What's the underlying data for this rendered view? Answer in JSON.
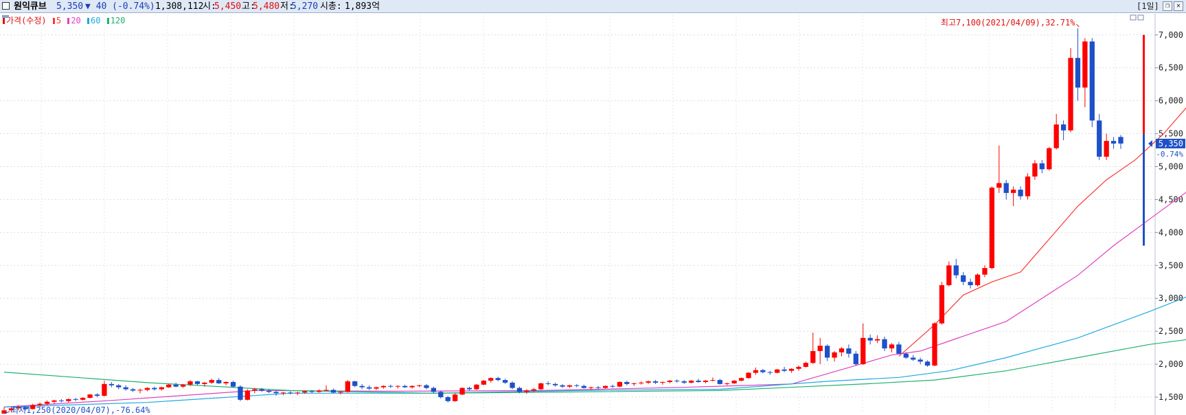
{
  "header": {
    "name": "원익큐브",
    "price": "5,350",
    "change": "▼ 40 (-0.74%)",
    "volume": "1,308,112",
    "open_label": "시:",
    "open": "5,450",
    "high_label": "고:",
    "high": "5,480",
    "low_label": "저:",
    "low": "5,270",
    "cap_label": "시총:",
    "cap": "1,893억",
    "period": "[1일]",
    "restore_icon": "restore-icon",
    "close_icon": "close-icon"
  },
  "legend": {
    "price": "가격(수정)",
    "ma5": "5",
    "ma20": "20",
    "ma60": "60",
    "ma120": "120"
  },
  "colors": {
    "up": "#ff0000",
    "down": "#1e50c8",
    "ma5": "#ff3333",
    "ma20": "#e040c0",
    "ma60": "#20a8e0",
    "ma120": "#20b070",
    "header_bg": "#dfe8f5"
  },
  "chart_data": {
    "type": "candlestick",
    "ylim": [
      1250,
      7300
    ],
    "yticks": [
      1500,
      2000,
      2500,
      3000,
      3500,
      4000,
      4500,
      5000,
      5500,
      6000,
      6500,
      7000
    ],
    "ytick_labels": [
      "1,500",
      "2,000",
      "2,500",
      "3,000",
      "3,500",
      "4,000",
      "4,500",
      "5,000",
      "5,500",
      "6,000",
      "6,500",
      "7,000"
    ],
    "current_price": 5350,
    "current_label": "5,350",
    "current_change": "-0.74%",
    "high_annotation": "최고7,100(2021/04/09),32.71%",
    "low_annotation": "최저1,250(2020/04/07),-76.64%",
    "ohlc": [
      [
        1250,
        1350,
        1250,
        1300
      ],
      [
        1300,
        1350,
        1270,
        1330
      ],
      [
        1330,
        1380,
        1300,
        1350
      ],
      [
        1350,
        1360,
        1300,
        1320
      ],
      [
        1320,
        1400,
        1310,
        1380
      ],
      [
        1380,
        1420,
        1350,
        1400
      ],
      [
        1400,
        1450,
        1380,
        1430
      ],
      [
        1430,
        1460,
        1400,
        1450
      ],
      [
        1450,
        1470,
        1420,
        1440
      ],
      [
        1440,
        1480,
        1420,
        1470
      ],
      [
        1470,
        1490,
        1440,
        1460
      ],
      [
        1460,
        1500,
        1450,
        1490
      ],
      [
        1490,
        1550,
        1480,
        1540
      ],
      [
        1540,
        1560,
        1500,
        1520
      ],
      [
        1520,
        1750,
        1510,
        1700
      ],
      [
        1700,
        1730,
        1650,
        1680
      ],
      [
        1680,
        1700,
        1620,
        1650
      ],
      [
        1650,
        1680,
        1600,
        1620
      ],
      [
        1620,
        1640,
        1580,
        1600
      ],
      [
        1600,
        1630,
        1560,
        1610
      ],
      [
        1610,
        1650,
        1590,
        1640
      ],
      [
        1640,
        1660,
        1600,
        1620
      ],
      [
        1620,
        1660,
        1600,
        1650
      ],
      [
        1650,
        1700,
        1640,
        1690
      ],
      [
        1690,
        1720,
        1650,
        1660
      ],
      [
        1660,
        1700,
        1640,
        1690
      ],
      [
        1690,
        1760,
        1670,
        1740
      ],
      [
        1740,
        1750,
        1680,
        1700
      ],
      [
        1700,
        1730,
        1660,
        1720
      ],
      [
        1720,
        1780,
        1700,
        1760
      ],
      [
        1760,
        1790,
        1700,
        1710
      ],
      [
        1710,
        1740,
        1680,
        1730
      ],
      [
        1730,
        1750,
        1640,
        1660
      ],
      [
        1660,
        1680,
        1440,
        1460
      ],
      [
        1460,
        1620,
        1450,
        1600
      ],
      [
        1600,
        1640,
        1560,
        1620
      ],
      [
        1620,
        1640,
        1580,
        1600
      ],
      [
        1600,
        1620,
        1560,
        1580
      ],
      [
        1580,
        1600,
        1520,
        1560
      ],
      [
        1560,
        1580,
        1530,
        1570
      ],
      [
        1570,
        1590,
        1540,
        1560
      ],
      [
        1560,
        1580,
        1530,
        1570
      ],
      [
        1570,
        1600,
        1550,
        1590
      ],
      [
        1590,
        1610,
        1560,
        1580
      ],
      [
        1580,
        1620,
        1570,
        1600
      ],
      [
        1600,
        1680,
        1590,
        1610
      ],
      [
        1610,
        1630,
        1560,
        1570
      ],
      [
        1570,
        1590,
        1540,
        1580
      ],
      [
        1580,
        1760,
        1570,
        1740
      ],
      [
        1740,
        1750,
        1650,
        1670
      ],
      [
        1670,
        1700,
        1620,
        1650
      ],
      [
        1650,
        1680,
        1610,
        1630
      ],
      [
        1630,
        1660,
        1610,
        1650
      ],
      [
        1650,
        1680,
        1630,
        1670
      ],
      [
        1670,
        1690,
        1640,
        1660
      ],
      [
        1660,
        1680,
        1630,
        1670
      ],
      [
        1670,
        1690,
        1640,
        1650
      ],
      [
        1650,
        1680,
        1630,
        1670
      ],
      [
        1670,
        1690,
        1650,
        1680
      ],
      [
        1680,
        1700,
        1620,
        1640
      ],
      [
        1640,
        1660,
        1560,
        1580
      ],
      [
        1580,
        1600,
        1480,
        1500
      ],
      [
        1500,
        1520,
        1420,
        1440
      ],
      [
        1440,
        1560,
        1430,
        1540
      ],
      [
        1540,
        1650,
        1530,
        1640
      ],
      [
        1640,
        1660,
        1600,
        1620
      ],
      [
        1620,
        1700,
        1610,
        1690
      ],
      [
        1690,
        1760,
        1680,
        1750
      ],
      [
        1750,
        1800,
        1720,
        1790
      ],
      [
        1790,
        1810,
        1740,
        1760
      ],
      [
        1760,
        1780,
        1700,
        1720
      ],
      [
        1720,
        1740,
        1620,
        1640
      ],
      [
        1640,
        1660,
        1560,
        1580
      ],
      [
        1580,
        1620,
        1550,
        1600
      ],
      [
        1600,
        1640,
        1580,
        1620
      ],
      [
        1620,
        1720,
        1610,
        1710
      ],
      [
        1710,
        1740,
        1680,
        1700
      ],
      [
        1700,
        1720,
        1660,
        1680
      ],
      [
        1680,
        1700,
        1640,
        1660
      ],
      [
        1660,
        1690,
        1640,
        1680
      ],
      [
        1680,
        1700,
        1650,
        1670
      ],
      [
        1670,
        1690,
        1630,
        1640
      ],
      [
        1640,
        1660,
        1610,
        1650
      ],
      [
        1650,
        1670,
        1620,
        1640
      ],
      [
        1640,
        1680,
        1630,
        1670
      ],
      [
        1670,
        1690,
        1640,
        1660
      ],
      [
        1660,
        1740,
        1650,
        1730
      ],
      [
        1730,
        1750,
        1680,
        1700
      ],
      [
        1700,
        1720,
        1670,
        1710
      ],
      [
        1710,
        1740,
        1690,
        1720
      ],
      [
        1720,
        1750,
        1700,
        1740
      ],
      [
        1740,
        1760,
        1700,
        1720
      ],
      [
        1720,
        1740,
        1690,
        1730
      ],
      [
        1730,
        1760,
        1710,
        1750
      ],
      [
        1750,
        1770,
        1720,
        1740
      ],
      [
        1740,
        1760,
        1700,
        1720
      ],
      [
        1720,
        1760,
        1710,
        1750
      ],
      [
        1750,
        1780,
        1720,
        1730
      ],
      [
        1730,
        1760,
        1710,
        1750
      ],
      [
        1750,
        1800,
        1740,
        1760
      ],
      [
        1760,
        1780,
        1690,
        1700
      ],
      [
        1700,
        1720,
        1680,
        1710
      ],
      [
        1710,
        1760,
        1700,
        1750
      ],
      [
        1750,
        1800,
        1740,
        1790
      ],
      [
        1790,
        1880,
        1780,
        1870
      ],
      [
        1870,
        1950,
        1840,
        1910
      ],
      [
        1910,
        1930,
        1860,
        1880
      ],
      [
        1880,
        1900,
        1840,
        1870
      ],
      [
        1870,
        1930,
        1860,
        1920
      ],
      [
        1920,
        1960,
        1880,
        1900
      ],
      [
        1900,
        1940,
        1870,
        1930
      ],
      [
        1930,
        1980,
        1900,
        1960
      ],
      [
        1960,
        2040,
        1950,
        2020
      ],
      [
        2020,
        2480,
        2000,
        2200
      ],
      [
        2200,
        2400,
        2000,
        2280
      ],
      [
        2280,
        2300,
        2050,
        2100
      ],
      [
        2100,
        2200,
        2040,
        2180
      ],
      [
        2180,
        2260,
        2120,
        2240
      ],
      [
        2240,
        2300,
        2100,
        2160
      ],
      [
        2160,
        2200,
        1980,
        2000
      ],
      [
        2000,
        2620,
        1990,
        2400
      ],
      [
        2400,
        2450,
        2300,
        2360
      ],
      [
        2360,
        2440,
        2320,
        2380
      ],
      [
        2380,
        2420,
        2200,
        2240
      ],
      [
        2240,
        2320,
        2180,
        2300
      ],
      [
        2300,
        2340,
        2150,
        2160
      ],
      [
        2160,
        2180,
        2080,
        2100
      ],
      [
        2100,
        2140,
        2050,
        2070
      ],
      [
        2070,
        2100,
        2000,
        2040
      ],
      [
        2040,
        2060,
        1960,
        1980
      ],
      [
        1980,
        2640,
        1970,
        2620
      ],
      [
        2620,
        3250,
        2600,
        3200
      ],
      [
        3200,
        3560,
        3180,
        3500
      ],
      [
        3500,
        3600,
        3300,
        3350
      ],
      [
        3350,
        3400,
        3200,
        3250
      ],
      [
        3250,
        3300,
        3150,
        3200
      ],
      [
        3200,
        3380,
        3180,
        3360
      ],
      [
        3360,
        3500,
        3320,
        3460
      ],
      [
        3460,
        4700,
        3440,
        4680
      ],
      [
        4680,
        5320,
        4600,
        4750
      ],
      [
        4750,
        4800,
        4500,
        4600
      ],
      [
        4600,
        4700,
        4400,
        4650
      ],
      [
        4650,
        4700,
        4500,
        4550
      ],
      [
        4550,
        4900,
        4500,
        4850
      ],
      [
        4850,
        5100,
        4800,
        5050
      ],
      [
        5050,
        5100,
        4900,
        4960
      ],
      [
        4960,
        5300,
        4940,
        5280
      ],
      [
        5280,
        5800,
        5260,
        5640
      ],
      [
        5640,
        5700,
        5400,
        5550
      ],
      [
        5550,
        6800,
        5520,
        6650
      ],
      [
        6650,
        7100,
        6000,
        6200
      ],
      [
        6200,
        6950,
        5900,
        6900
      ],
      [
        6900,
        6950,
        5600,
        5700
      ],
      [
        5700,
        5800,
        5100,
        5150
      ],
      [
        5150,
        5500,
        5100,
        5390
      ],
      [
        5390,
        5450,
        5270,
        5350
      ],
      [
        5450,
        5480,
        5270,
        5350
      ]
    ],
    "ma": [
      {
        "name": "5",
        "color": "#ff3333",
        "points": [
          [
            125,
            2120
          ],
          [
            130,
            2600
          ],
          [
            134,
            3050
          ],
          [
            138,
            3250
          ],
          [
            142,
            3400
          ],
          [
            146,
            3900
          ],
          [
            150,
            4400
          ],
          [
            154,
            4800
          ],
          [
            158,
            5100
          ],
          [
            162,
            5500
          ],
          [
            166,
            6000
          ],
          [
            170,
            5900
          ],
          [
            172,
            5500
          ],
          [
            174,
            5400
          ]
        ]
      },
      {
        "name": "20",
        "color": "#e040c0",
        "points": [
          [
            0,
            1350
          ],
          [
            15,
            1450
          ],
          [
            35,
            1600
          ],
          [
            55,
            1590
          ],
          [
            75,
            1600
          ],
          [
            95,
            1650
          ],
          [
            110,
            1700
          ],
          [
            118,
            1950
          ],
          [
            124,
            2140
          ],
          [
            128,
            2200
          ],
          [
            132,
            2350
          ],
          [
            136,
            2500
          ],
          [
            140,
            2650
          ],
          [
            145,
            3000
          ],
          [
            150,
            3350
          ],
          [
            155,
            3800
          ],
          [
            160,
            4200
          ],
          [
            165,
            4600
          ],
          [
            170,
            5000
          ],
          [
            174,
            5150
          ]
        ]
      },
      {
        "name": "60",
        "color": "#20a8e0",
        "points": [
          [
            0,
            1350
          ],
          [
            20,
            1420
          ],
          [
            40,
            1560
          ],
          [
            60,
            1560
          ],
          [
            80,
            1600
          ],
          [
            100,
            1620
          ],
          [
            115,
            1740
          ],
          [
            125,
            1800
          ],
          [
            132,
            1900
          ],
          [
            140,
            2100
          ],
          [
            150,
            2400
          ],
          [
            160,
            2800
          ],
          [
            167,
            3100
          ],
          [
            174,
            3360
          ]
        ]
      },
      {
        "name": "120",
        "color": "#20b070",
        "points": [
          [
            0,
            1880
          ],
          [
            20,
            1720
          ],
          [
            40,
            1600
          ],
          [
            60,
            1560
          ],
          [
            80,
            1580
          ],
          [
            100,
            1600
          ],
          [
            120,
            1700
          ],
          [
            130,
            1760
          ],
          [
            140,
            1900
          ],
          [
            150,
            2100
          ],
          [
            160,
            2300
          ],
          [
            170,
            2440
          ],
          [
            174,
            2520
          ]
        ]
      }
    ]
  }
}
